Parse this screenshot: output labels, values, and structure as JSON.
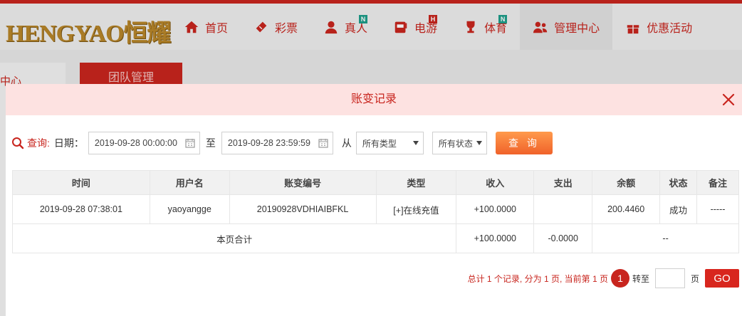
{
  "brand": {
    "logo_text": "HENGYAO恒耀"
  },
  "nav": {
    "items": [
      {
        "label": "首页",
        "icon": "home-icon"
      },
      {
        "label": "彩票",
        "icon": "ticket-icon"
      },
      {
        "label": "真人",
        "icon": "person-icon",
        "badge": "N"
      },
      {
        "label": "电游",
        "icon": "slot-machine-icon",
        "badge": "H"
      },
      {
        "label": "体育",
        "icon": "trophy-icon",
        "badge": "N"
      },
      {
        "label": "管理中心",
        "icon": "users-icon"
      },
      {
        "label": "优惠活动",
        "icon": "gift-icon"
      }
    ]
  },
  "background": {
    "sidebar_label": "中心",
    "tab_label": "团队管理"
  },
  "modal": {
    "title": "账变记录",
    "query": {
      "label": "查询:",
      "date_label": "日期：",
      "start_date": "2019-09-28 00:00:00",
      "to_label": "至",
      "end_date": "2019-09-28 23:59:59",
      "from_label": "从",
      "type_select": "所有类型",
      "status_select": "所有状态",
      "submit_label": "查 询"
    },
    "table": {
      "headers": [
        "时间",
        "用户名",
        "账变编号",
        "类型",
        "收入",
        "支出",
        "余额",
        "状态",
        "备注"
      ],
      "rows": [
        [
          "2019-09-28 07:38:01",
          "yaoyangge",
          "20190928VDHIAIBFKL",
          "[+]在线充值",
          "+100.0000",
          "",
          "200.4460",
          "成功",
          "-----"
        ]
      ],
      "summary": {
        "label": "本页合计",
        "income": "+100.0000",
        "expense": "-0.0000",
        "rest": "--"
      }
    },
    "pager": {
      "summary": "总计 1 个记录, 分为 1 页, 当前第 1 页",
      "current_page": "1",
      "goto_label": "转至",
      "page_unit": "页",
      "go_label": "GO"
    }
  },
  "colors": {
    "brand_red": "#c8251e",
    "income_green": "#2e9d2e",
    "header_pink": "#fde2e1",
    "query_orange": "#f0622a"
  }
}
